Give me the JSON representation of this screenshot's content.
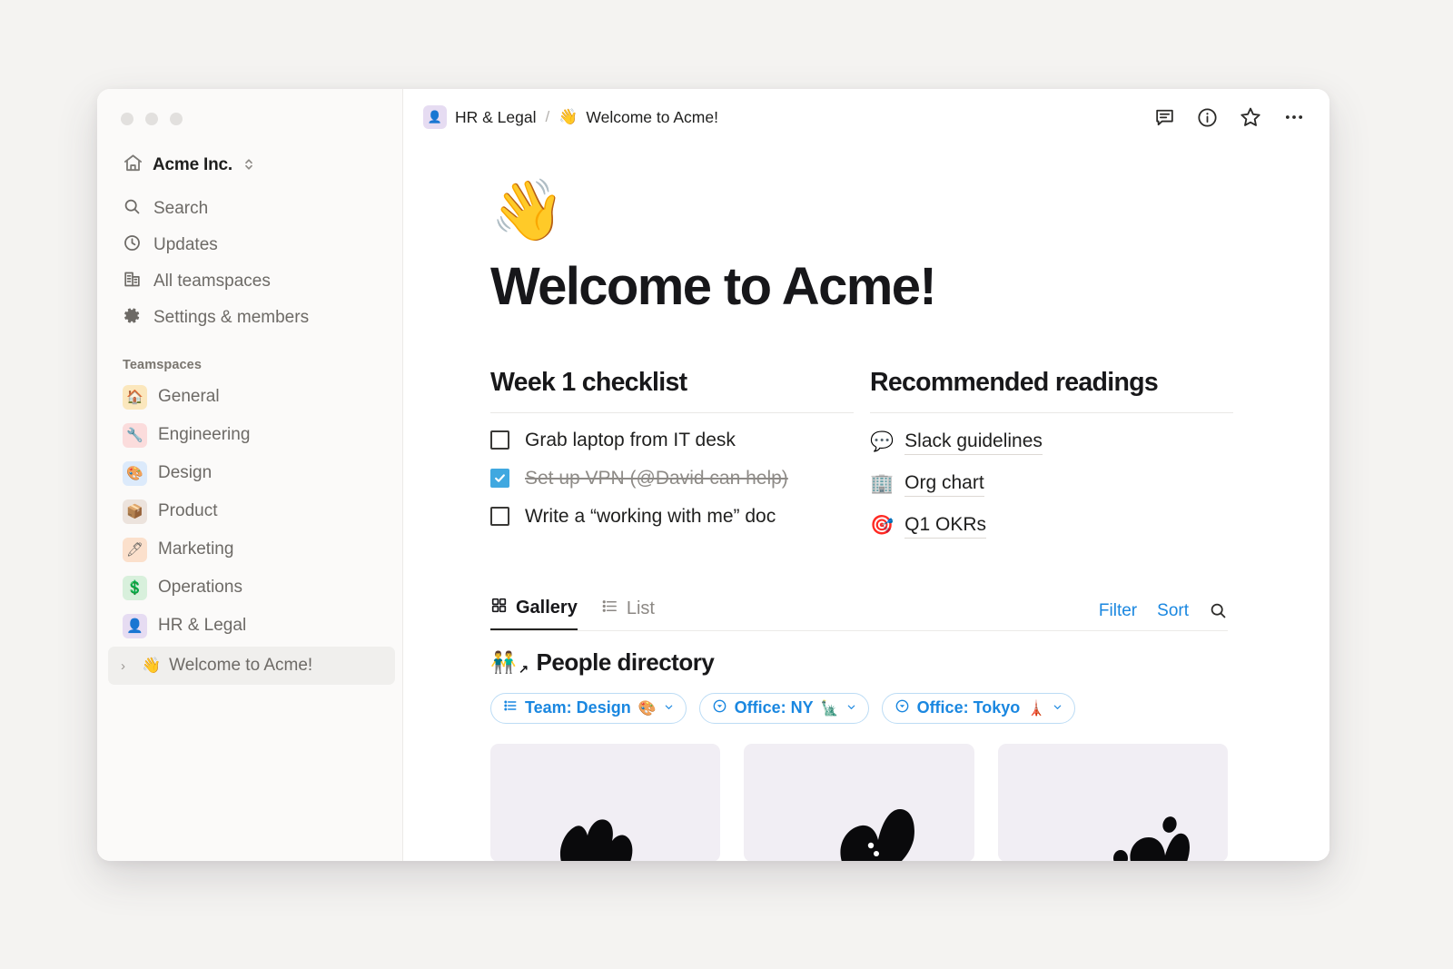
{
  "window": {
    "traffic_lights": [
      "close",
      "minimize",
      "zoom"
    ]
  },
  "sidebar": {
    "workspace": {
      "name": "Acme Inc.",
      "icon": "home-icon",
      "chevron": "⌃⌄"
    },
    "nav": [
      {
        "label": "Search",
        "icon": "search-icon"
      },
      {
        "label": "Updates",
        "icon": "clock-icon"
      },
      {
        "label": "All teamspaces",
        "icon": "building-icon"
      },
      {
        "label": "Settings & members",
        "icon": "gear-icon"
      }
    ],
    "section_title": "Teamspaces",
    "teamspaces": [
      {
        "label": "General",
        "emoji": "🏠",
        "bg": "#fbe7bd"
      },
      {
        "label": "Engineering",
        "emoji": "🔧",
        "bg": "#fbdcdc"
      },
      {
        "label": "Design",
        "emoji": "🎨",
        "bg": "#dceafb"
      },
      {
        "label": "Product",
        "emoji": "📦",
        "bg": "#ece3dd"
      },
      {
        "label": "Marketing",
        "emoji": "🖊",
        "bg": "#fbe0cc"
      },
      {
        "label": "Operations",
        "emoji": "💲",
        "bg": "#d8f0dc"
      },
      {
        "label": "HR & Legal",
        "emoji": "👤",
        "bg": "#e6dcf2"
      }
    ],
    "selected_page": {
      "label": "Welcome to Acme!",
      "emoji": "👋",
      "caret": "›"
    }
  },
  "header": {
    "breadcrumb": [
      {
        "label": "HR & Legal",
        "emoji": "👤",
        "type": "teamspace"
      },
      {
        "label": "Welcome to Acme!",
        "emoji": "👋",
        "type": "page"
      }
    ],
    "separator": "/",
    "actions": [
      {
        "name": "comment-icon"
      },
      {
        "name": "info-icon"
      },
      {
        "name": "star-icon"
      },
      {
        "name": "more-icon"
      }
    ]
  },
  "page": {
    "emoji": "👋",
    "title": "Welcome to Acme!"
  },
  "checklist": {
    "heading": "Week 1 checklist",
    "items": [
      {
        "label": "Grab laptop from IT desk",
        "checked": false
      },
      {
        "label": "Set up VPN (@David can help)",
        "checked": true
      },
      {
        "label": "Write a “working with me” doc",
        "checked": false
      }
    ]
  },
  "readings": {
    "heading": "Recommended readings",
    "items": [
      {
        "label": "Slack guidelines",
        "emoji": "💬"
      },
      {
        "label": "Org chart",
        "emoji": "🏢"
      },
      {
        "label": "Q1 OKRs",
        "emoji": "🎯"
      }
    ]
  },
  "database": {
    "views": [
      {
        "label": "Gallery",
        "icon": "grid-icon",
        "active": true
      },
      {
        "label": "List",
        "icon": "list-icon",
        "active": false
      }
    ],
    "tools": {
      "filter_label": "Filter",
      "sort_label": "Sort",
      "search_icon": "search-icon"
    },
    "title": "People directory",
    "title_emoji": "👬",
    "linked_arrow": "↗",
    "filters": [
      {
        "label": "Team: Design",
        "emoji": "🎨",
        "icon": "list-icon",
        "chevron": "⌄"
      },
      {
        "label": "Office: NY",
        "emoji": "🗽",
        "icon": "select-icon",
        "chevron": "⌄"
      },
      {
        "label": "Office: Tokyo",
        "emoji": "🗼",
        "icon": "select-icon",
        "chevron": "⌄"
      }
    ],
    "cards": [
      {
        "name": "gallery-card-1"
      },
      {
        "name": "gallery-card-2"
      },
      {
        "name": "gallery-card-3"
      }
    ]
  },
  "colors": {
    "accent_blue": "#1a87e0",
    "checkbox_blue": "#40a8e0",
    "sidebar_bg": "#fbfaf9",
    "card_bg": "#f1eef4",
    "desktop_bg": "#f4f3f1"
  }
}
